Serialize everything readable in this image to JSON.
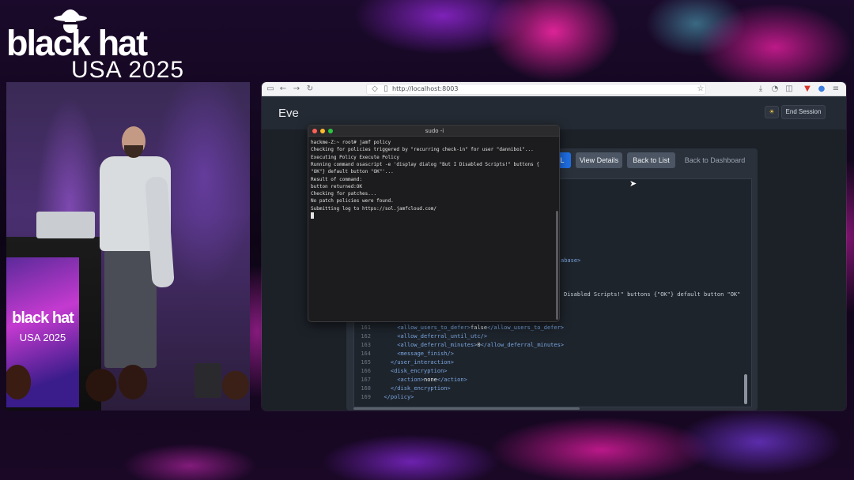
{
  "event_logo": {
    "brand": "black hat",
    "event": "USA 2025"
  },
  "podium_logo": {
    "brand": "black hat",
    "event": "USA 2025"
  },
  "browser": {
    "url": "http://localhost:8003"
  },
  "app": {
    "title": "Eve",
    "end_session_label": "End Session",
    "theme_icon": "sun-icon"
  },
  "toolbar": {
    "primary_partial_label": "L",
    "view_details_label": "View Details",
    "back_to_list_label": "Back to List",
    "back_to_dashboard_label": "Back to Dashboard"
  },
  "terminal": {
    "title": "sudo -i",
    "lines": [
      "hackme-Z:~ root# jamf policy",
      "Checking for policies triggered by \"recurring check-in\" for user \"danniboi\"...",
      "Executing Policy Execute Policy",
      "Running command osascript -e 'display dialog \"But I Disabled Scripts!\" buttons {",
      "\"OK\"} default button \"OK\"'...",
      "Result of command:",
      "button returned:OK",
      "Checking for patches...",
      "No patch policies were found.",
      "Submitting log to https://sol.jamfcloud.com/"
    ]
  },
  "code_fragments": {
    "database_tail": "abase>",
    "dialog_tail": "Disabled Scripts!\" buttons {\"OK\"} default button \"OK\""
  },
  "code_lines": [
    {
      "num": "161",
      "indent": "      ",
      "open": "<allow_users_to_defer>",
      "value": "false",
      "close": "</allow_users_to_defer>"
    },
    {
      "num": "162",
      "indent": "      ",
      "open": "<allow_deferral_until_utc/>",
      "value": "",
      "close": ""
    },
    {
      "num": "163",
      "indent": "      ",
      "open": "<allow_deferral_minutes>",
      "value": "0",
      "close": "</allow_deferral_minutes>"
    },
    {
      "num": "164",
      "indent": "      ",
      "open": "<message_finish/>",
      "value": "",
      "close": ""
    },
    {
      "num": "165",
      "indent": "    ",
      "open": "</user_interaction>",
      "value": "",
      "close": ""
    },
    {
      "num": "166",
      "indent": "    ",
      "open": "<disk_encryption>",
      "value": "",
      "close": ""
    },
    {
      "num": "167",
      "indent": "      ",
      "open": "<action>",
      "value": "none",
      "close": "</action>"
    },
    {
      "num": "168",
      "indent": "    ",
      "open": "</disk_encryption>",
      "value": "",
      "close": ""
    },
    {
      "num": "169",
      "indent": "  ",
      "open": "</policy>",
      "value": "",
      "close": ""
    }
  ]
}
